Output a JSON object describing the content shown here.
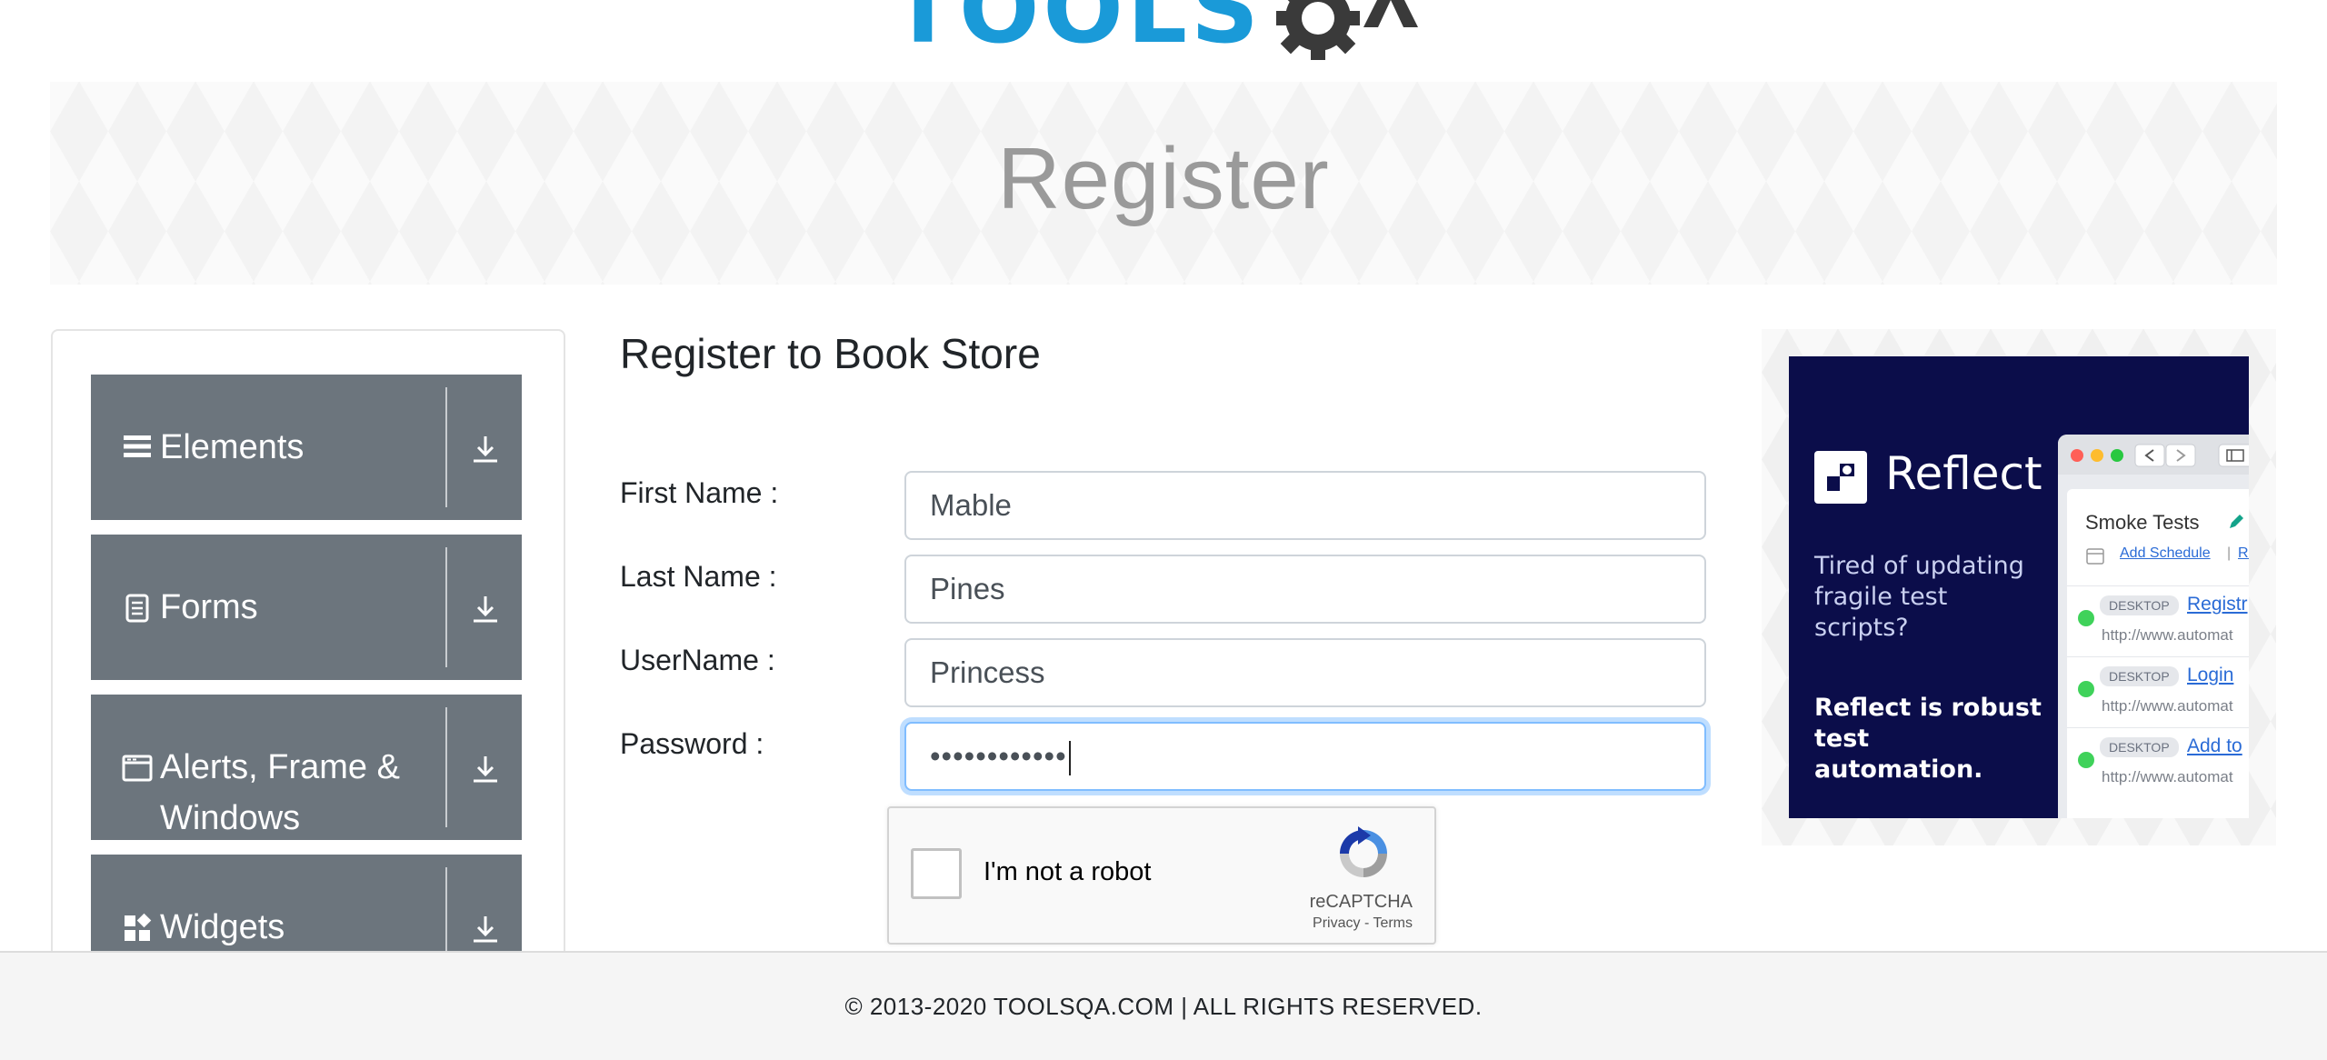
{
  "logo": {
    "text": "TOOLS"
  },
  "banner": {
    "title": "Register"
  },
  "sidebar": {
    "groups": [
      {
        "label": "Elements",
        "icon": "menu-lines-icon"
      },
      {
        "label": "Forms",
        "icon": "document-icon"
      },
      {
        "label": "Alerts, Frame &",
        "label2": "Windows",
        "icon": "window-icon"
      },
      {
        "label": "Widgets",
        "icon": "widgets-icon"
      }
    ]
  },
  "form": {
    "title": "Register to Book Store",
    "first_name_label": "First Name :",
    "first_name_value": "Mable",
    "last_name_label": "Last Name :",
    "last_name_value": "Pines",
    "username_label": "UserName :",
    "username_value": "Princess",
    "password_label": "Password :",
    "password_value": "••••••••••••"
  },
  "captcha": {
    "label": "I'm not a robot",
    "brand": "reCAPTCHA",
    "privacy": "Privacy",
    "separator": " - ",
    "terms": "Terms"
  },
  "ad": {
    "brand": "Reflect",
    "tagline1": "Tired of updating fragile test scripts?",
    "tagline2": "Reflect is robust test automation.",
    "window": {
      "title": "Smoke Tests",
      "schedule": "Add Schedule",
      "schedule_sep": "|",
      "run": "Ru",
      "rows": [
        {
          "badge": "DESKTOP",
          "link": "Registr",
          "url": "http://www.automat"
        },
        {
          "badge": "DESKTOP",
          "link": "Login",
          "url": "http://www.automat"
        },
        {
          "badge": "DESKTOP",
          "link": "Add to",
          "url": "http://www.automat"
        }
      ]
    }
  },
  "footer": {
    "text": "© 2013-2020 TOOLSQA.COM | ALL RIGHTS RESERVED."
  },
  "colors": {
    "sidebar_header": "#6c757d",
    "ad_background": "#0b0d4a",
    "logo_blue": "#1a9ad8",
    "focus_ring": "#80bdff"
  }
}
